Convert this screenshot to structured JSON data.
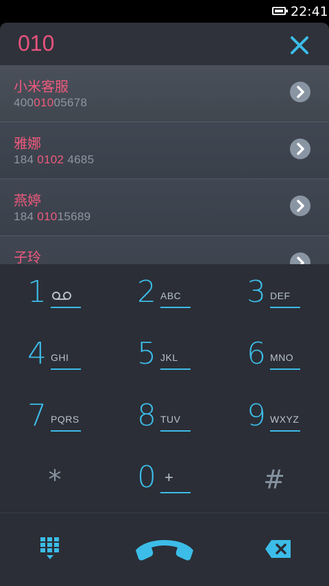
{
  "status": {
    "time": "22:41"
  },
  "search": {
    "query": "010"
  },
  "results": [
    {
      "name": "小米客服",
      "number_pre": "400",
      "number_hl": "010",
      "number_post": "05678"
    },
    {
      "name": "雅娜",
      "number_pre": "184 ",
      "number_hl": "0102",
      "number_post": " 4685"
    },
    {
      "name": "燕婷",
      "number_pre": "184 ",
      "number_hl": "010",
      "number_post": "15689"
    },
    {
      "name": "子玲",
      "number_pre": "",
      "number_hl": "",
      "number_post": ""
    }
  ],
  "dialpad": {
    "keys": [
      {
        "digit": "1",
        "letters": ""
      },
      {
        "digit": "2",
        "letters": "ABC"
      },
      {
        "digit": "3",
        "letters": "DEF"
      },
      {
        "digit": "4",
        "letters": "GHI"
      },
      {
        "digit": "5",
        "letters": "JKL"
      },
      {
        "digit": "6",
        "letters": "MNO"
      },
      {
        "digit": "7",
        "letters": "PQRS"
      },
      {
        "digit": "8",
        "letters": "TUV"
      },
      {
        "digit": "9",
        "letters": "WXYZ"
      },
      {
        "digit": "*",
        "letters": ""
      },
      {
        "digit": "0",
        "letters": "+"
      },
      {
        "digit": "#",
        "letters": ""
      }
    ]
  },
  "colors": {
    "accent": "#3cbce8",
    "highlight": "#f05a7e",
    "background": "#2b2e36"
  }
}
